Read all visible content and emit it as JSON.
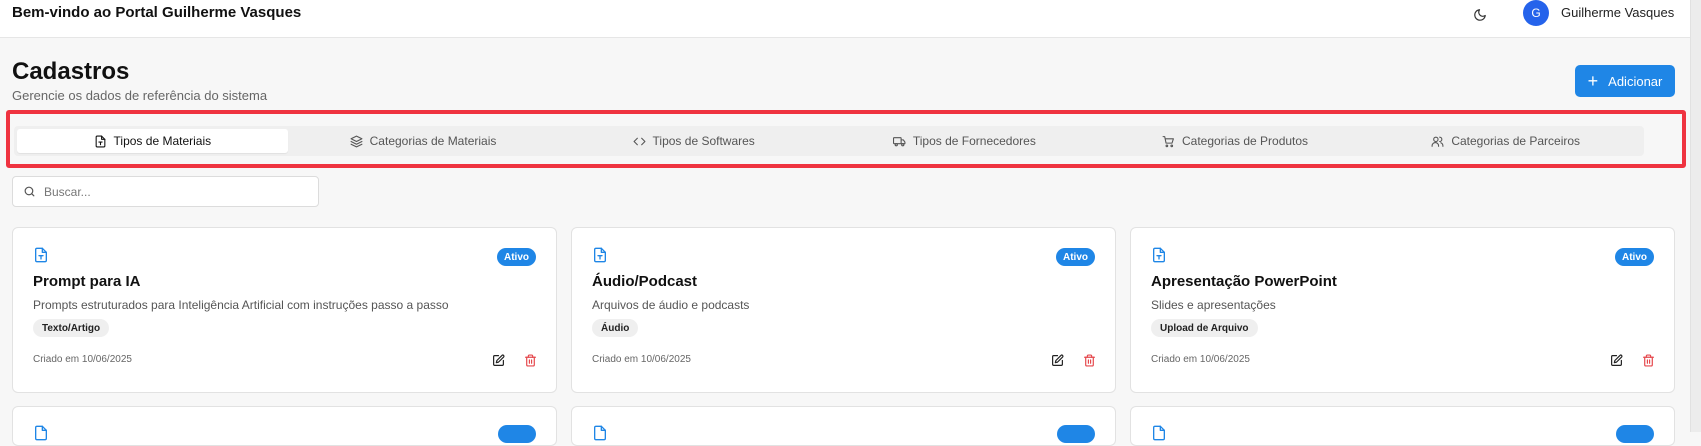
{
  "header": {
    "welcome": "Bem-vindo ao Portal Guilherme Vasques",
    "theme_icon": "moon-icon",
    "user_initial": "G",
    "user_name": "Guilherme Vasques"
  },
  "page": {
    "title": "Cadastros",
    "subtitle": "Gerencie os dados de referência do sistema",
    "add_label": "Adicionar"
  },
  "tabs": [
    {
      "label": "Tipos de Materiais",
      "icon": "file-type-icon",
      "active": true
    },
    {
      "label": "Categorias de Materiais",
      "icon": "layers-icon",
      "active": false
    },
    {
      "label": "Tipos de Softwares",
      "icon": "code-icon",
      "active": false
    },
    {
      "label": "Tipos de Fornecedores",
      "icon": "truck-icon",
      "active": false
    },
    {
      "label": "Categorias de Produtos",
      "icon": "cart-icon",
      "active": false
    },
    {
      "label": "Categorias de Parceiros",
      "icon": "users-icon",
      "active": false
    }
  ],
  "search": {
    "placeholder": "Buscar..."
  },
  "cards": [
    {
      "title": "Prompt para IA",
      "description": "Prompts estruturados para Inteligência Artificial com instruções passo a passo",
      "tag": "Texto/Artigo",
      "status": "Ativo",
      "created": "Criado em 10/06/2025"
    },
    {
      "title": "Áudio/Podcast",
      "description": "Arquivos de áudio e podcasts",
      "tag": "Áudio",
      "status": "Ativo",
      "created": "Criado em 10/06/2025"
    },
    {
      "title": "Apresentação PowerPoint",
      "description": "Slides e apresentações",
      "tag": "Upload de Arquivo",
      "status": "Ativo",
      "created": "Criado em 10/06/2025"
    }
  ],
  "colors": {
    "accent": "#1f86e6",
    "avatar": "#2563eb",
    "highlight": "#ef3340",
    "delete": "#e5484d"
  }
}
